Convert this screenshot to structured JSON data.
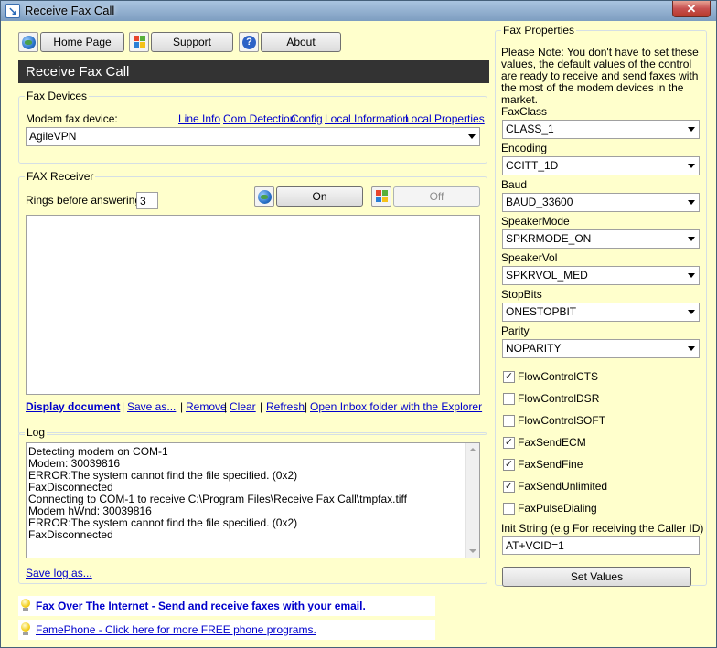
{
  "window": {
    "title": "Receive Fax Call",
    "close_label": "✕"
  },
  "toolbar": {
    "home_label": "Home Page",
    "support_label": "Support",
    "about_label": "About"
  },
  "header": {
    "title": "Receive Fax Call"
  },
  "fax_devices": {
    "group_label": "Fax Devices",
    "modem_label": "Modem fax device:",
    "links": [
      "Line Info",
      "Com Detection",
      "Config",
      "Local Information",
      "Local Properties"
    ],
    "selected_device": "AgileVPN"
  },
  "fax_receiver": {
    "group_label": "FAX Receiver",
    "rings_label": "Rings before answering:",
    "rings_value": "3",
    "on_label": "On",
    "off_label": "Off",
    "links": [
      "Display document",
      "Save as...",
      "Remove",
      "Clear",
      "Refresh",
      "Open Inbox folder with the Explorer"
    ],
    "separator": "|"
  },
  "log": {
    "group_label": "Log",
    "lines": [
      "Detecting modem on COM-1",
      "Modem: 30039816",
      "ERROR:The system cannot find the file specified. (0x2)",
      "FaxDisconnected",
      "Connecting to COM-1 to receive C:\\Program Files\\Receive Fax Call\\tmpfax.tiff",
      "Modem hWnd: 30039816",
      "ERROR:The system cannot find the file specified. (0x2)",
      "FaxDisconnected"
    ],
    "save_link": "Save log as..."
  },
  "promos": [
    {
      "text": "Fax Over The Internet - Send and receive faxes with your email."
    },
    {
      "text": "FamePhone - Click here for more FREE phone programs."
    }
  ],
  "fax_properties": {
    "group_label": "Fax Properties",
    "note": "Please Note: You don't have to set these values, the default values of the control are ready to receive and send faxes with the most of the modem devices in the market.",
    "fields": [
      {
        "label": "FaxClass",
        "value": "CLASS_1"
      },
      {
        "label": "Encoding",
        "value": "CCITT_1D"
      },
      {
        "label": "Baud",
        "value": "BAUD_33600"
      },
      {
        "label": "SpeakerMode",
        "value": "SPKRMODE_ON"
      },
      {
        "label": "SpeakerVol",
        "value": "SPKRVOL_MED"
      },
      {
        "label": "StopBits",
        "value": "ONESTOPBIT"
      },
      {
        "label": "Parity",
        "value": "NOPARITY"
      }
    ],
    "checkboxes": [
      {
        "label": "FlowControlCTS",
        "checked": true
      },
      {
        "label": "FlowControlDSR",
        "checked": false
      },
      {
        "label": "FlowControlSOFT",
        "checked": false
      },
      {
        "label": "FaxSendECM",
        "checked": true
      },
      {
        "label": "FaxSendFine",
        "checked": true
      },
      {
        "label": "FaxSendUnlimited",
        "checked": true
      },
      {
        "label": "FaxPulseDialing",
        "checked": false
      }
    ],
    "init_label": "Init String (e.g For receiving the Caller ID)",
    "init_value": "AT+VCID=1",
    "set_button": "Set Values"
  }
}
